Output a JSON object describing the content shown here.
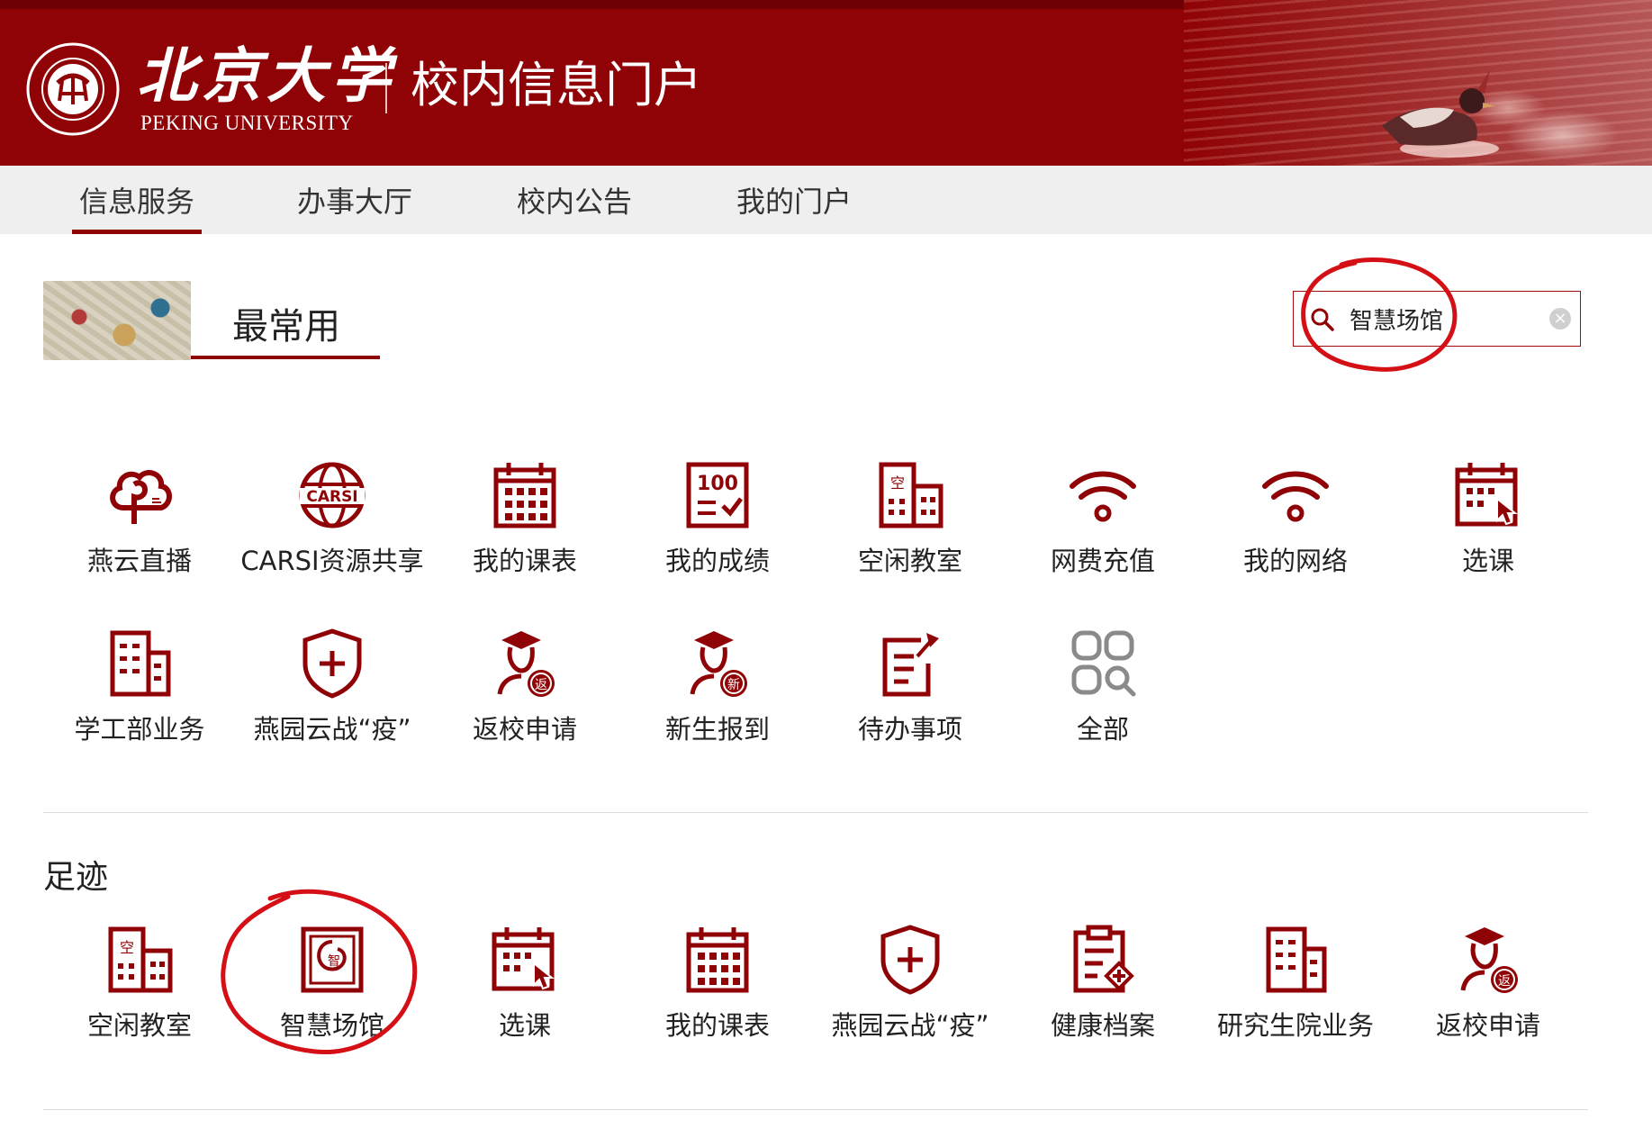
{
  "header": {
    "university_cn": "北京大学",
    "university_en": "PEKING UNIVERSITY",
    "portal_title": "校内信息门户"
  },
  "nav": {
    "items": [
      {
        "label": "信息服务",
        "active": true
      },
      {
        "label": "办事大厅",
        "active": false
      },
      {
        "label": "校内公告",
        "active": false
      },
      {
        "label": "我的门户",
        "active": false
      }
    ]
  },
  "most_used": {
    "title": "最常用",
    "apps": [
      {
        "label": "燕云直播",
        "icon": "cloud-broadcast-icon"
      },
      {
        "label": "CARSI资源共享",
        "icon": "carsi-globe-icon"
      },
      {
        "label": "我的课表",
        "icon": "calendar-icon"
      },
      {
        "label": "我的成绩",
        "icon": "score-100-icon"
      },
      {
        "label": "空闲教室",
        "icon": "building-empty-icon"
      },
      {
        "label": "网费充值",
        "icon": "wifi-icon"
      },
      {
        "label": "我的网络",
        "icon": "wifi-icon"
      },
      {
        "label": "选课",
        "icon": "calendar-click-icon"
      },
      {
        "label": "学工部业务",
        "icon": "building-icon"
      },
      {
        "label": "燕园云战“疫”",
        "icon": "shield-plus-icon"
      },
      {
        "label": "返校申请",
        "icon": "graduate-return-icon"
      },
      {
        "label": "新生报到",
        "icon": "graduate-new-icon"
      },
      {
        "label": "待办事项",
        "icon": "todo-pin-icon"
      },
      {
        "label": "全部",
        "icon": "all-apps-icon"
      }
    ]
  },
  "search": {
    "value": "智慧场馆",
    "clear_glyph": "×"
  },
  "footprint": {
    "title": "足迹",
    "apps": [
      {
        "label": "空闲教室",
        "icon": "building-empty-icon"
      },
      {
        "label": "智慧场馆",
        "icon": "smart-venue-icon"
      },
      {
        "label": "选课",
        "icon": "calendar-click-icon"
      },
      {
        "label": "我的课表",
        "icon": "calendar-icon"
      },
      {
        "label": "燕园云战“疫”",
        "icon": "shield-plus-icon"
      },
      {
        "label": "健康档案",
        "icon": "health-record-icon"
      },
      {
        "label": "研究生院业务",
        "icon": "building-icon"
      },
      {
        "label": "返校申请",
        "icon": "graduate-return-icon"
      }
    ]
  },
  "colors": {
    "brand": "#8f0205",
    "annotation": "#d40f16",
    "gray_icon": "#8a8a8a"
  }
}
